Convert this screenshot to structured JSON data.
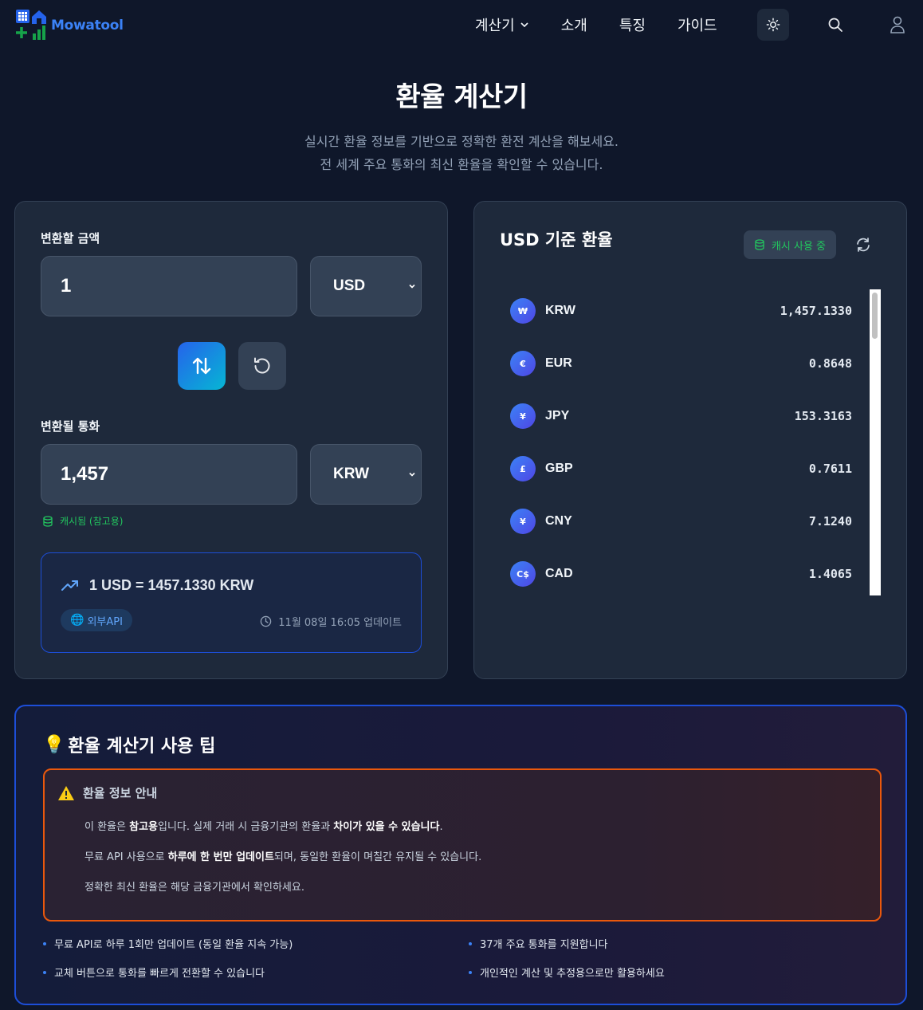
{
  "app": {
    "name": "Mowatool"
  },
  "nav": {
    "calculator": "계산기",
    "about": "소개",
    "features": "특징",
    "guide": "가이드"
  },
  "hero": {
    "title": "환율 계산기",
    "subtitle_line1": "실시간 환율 정보를 기반으로 정확한 환전 계산을 해보세요.",
    "subtitle_line2": "전 세계 주요 통화의 최신 환율을 확인할 수 있습니다."
  },
  "converter": {
    "from_label": "변환할 금액",
    "from_amount": "1",
    "from_currency": "USD",
    "to_label": "변환될 통화",
    "to_amount": "1,457",
    "to_currency": "KRW",
    "cache_note": "캐시됨 (참고용)",
    "rate_line": "1 USD = 1457.1330 KRW",
    "api_badge": "외부API",
    "updated": "11월 08일 16:05 업데이트"
  },
  "rates": {
    "title": "USD 기준 환율",
    "cache_badge": "캐시 사용 중",
    "items": [
      {
        "symbol": "₩",
        "code": "KRW",
        "rate": "1,457.1330"
      },
      {
        "symbol": "€",
        "code": "EUR",
        "rate": "0.8648"
      },
      {
        "symbol": "¥",
        "code": "JPY",
        "rate": "153.3163"
      },
      {
        "symbol": "£",
        "code": "GBP",
        "rate": "0.7611"
      },
      {
        "symbol": "¥",
        "code": "CNY",
        "rate": "7.1240"
      },
      {
        "symbol": "C$",
        "code": "CAD",
        "rate": "1.4065"
      }
    ]
  },
  "tips": {
    "title": "환율 계산기 사용 팁",
    "notice_title": "환율 정보 안내",
    "p1_a": "이 환율은 ",
    "p1_b": "참고용",
    "p1_c": "입니다. 실제 거래 시 금융기관의 환율과 ",
    "p1_d": "차이가 있을 수 있습니다",
    "p1_e": ".",
    "p2_a": "무료 API 사용으로 ",
    "p2_b": "하루에 한 번만 업데이트",
    "p2_c": "되며, 동일한 환율이 며칠간 유지될 수 있습니다.",
    "p3": "정확한 최신 환율은 해당 금융기관에서 확인하세요.",
    "bullets": [
      "무료 API로 하루 1회만 업데이트 (동일 환율 지속 가능)",
      "37개 주요 통화를 지원합니다",
      "교체 버튼으로 통화를 빠르게 전환할 수 있습니다",
      "개인적인 계산 및 추정용으로만 활용하세요"
    ]
  },
  "colors": {
    "accent": "#3b82f6",
    "success": "#22c55e",
    "warning": "#ea580c",
    "background": "#0f172a",
    "card": "#1e293b"
  }
}
